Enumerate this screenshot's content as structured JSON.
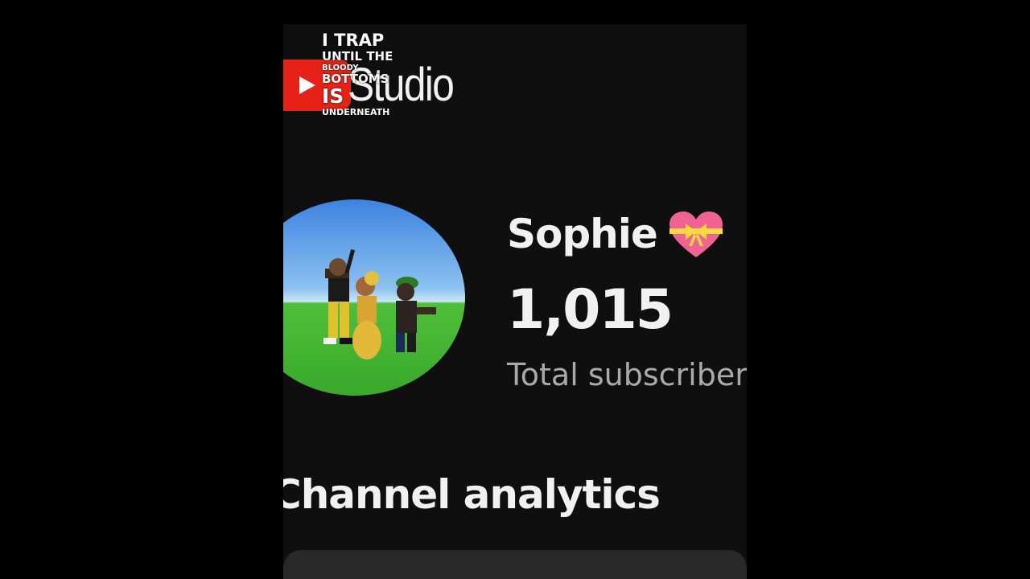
{
  "header": {
    "app_name": "Studio",
    "caption_lines": [
      "I TRAP",
      "UNTIL THE",
      "BLOODY",
      "BOTTOMS",
      "IS",
      "UNDERNEATH"
    ]
  },
  "channel": {
    "name": "Sophie",
    "name_emoji": "heart-with-ribbon-icon",
    "subscriber_count": "1,015",
    "subscriber_label": "Total subscribers"
  },
  "sections": {
    "analytics_title": "Channel analytics"
  },
  "colors": {
    "background": "#0f0f0f",
    "text_primary": "#f1f1f1",
    "text_secondary": "#aaaaaa",
    "brand_red": "#e62117",
    "heart_pink": "#f06292",
    "ribbon_yellow": "#ffd740"
  }
}
